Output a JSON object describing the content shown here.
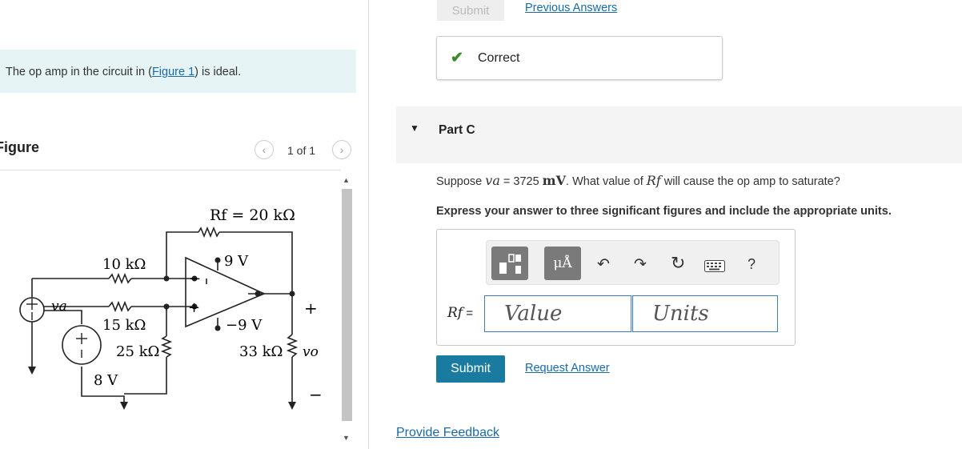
{
  "problem": {
    "intro_prefix": "The op amp in the circuit in (",
    "figure_link": "Figure 1",
    "intro_suffix": ") is ideal."
  },
  "figure_panel": {
    "title": "Figure",
    "pager": "1 of 1",
    "prev_icon": "chevron-left-icon",
    "next_icon": "chevron-right-icon"
  },
  "circuit": {
    "rf": "Rf = 20 kΩ",
    "r1": "10 kΩ",
    "r2": "15 kΩ",
    "r3": "25 kΩ",
    "rl": "33 kΩ",
    "vpos": "9 V",
    "vneg": "−9 V",
    "vsrc": "8 V",
    "va": "va",
    "vo": "vo",
    "plus": "+",
    "minus": "−"
  },
  "previous_part": {
    "submit_label": "Submit",
    "previous_answers": "Previous Answers",
    "status": "Correct",
    "status_color": "#3a8c2b"
  },
  "part_c": {
    "label": "Part C",
    "q_prefix": "Suppose ",
    "q_var": "va",
    "q_eq": " = 3725 ",
    "q_unit": "mV",
    "q_mid": ". What value of ",
    "q_rf": "Rf",
    "q_suffix": " will cause the op amp to saturate?",
    "instruction": "Express your answer to three significant figures and include the appropriate units.",
    "toolbar": {
      "template_icon": "templates-icon",
      "units_label": "μÅ",
      "undo_icon": "undo-icon",
      "redo_icon": "redo-icon",
      "reset_icon": "reset-icon",
      "keyboard_icon": "keyboard-icon",
      "help_label": "?"
    },
    "answer_var": "Rf",
    "answer_eq": " =",
    "value_placeholder": "Value",
    "units_placeholder": "Units",
    "submit_label": "Submit",
    "request_answer": "Request Answer"
  },
  "feedback": "Provide Feedback",
  "colors": {
    "accent": "#1a7ba0",
    "link": "#1a6aa5",
    "intro_band": "#e6f4f6"
  }
}
